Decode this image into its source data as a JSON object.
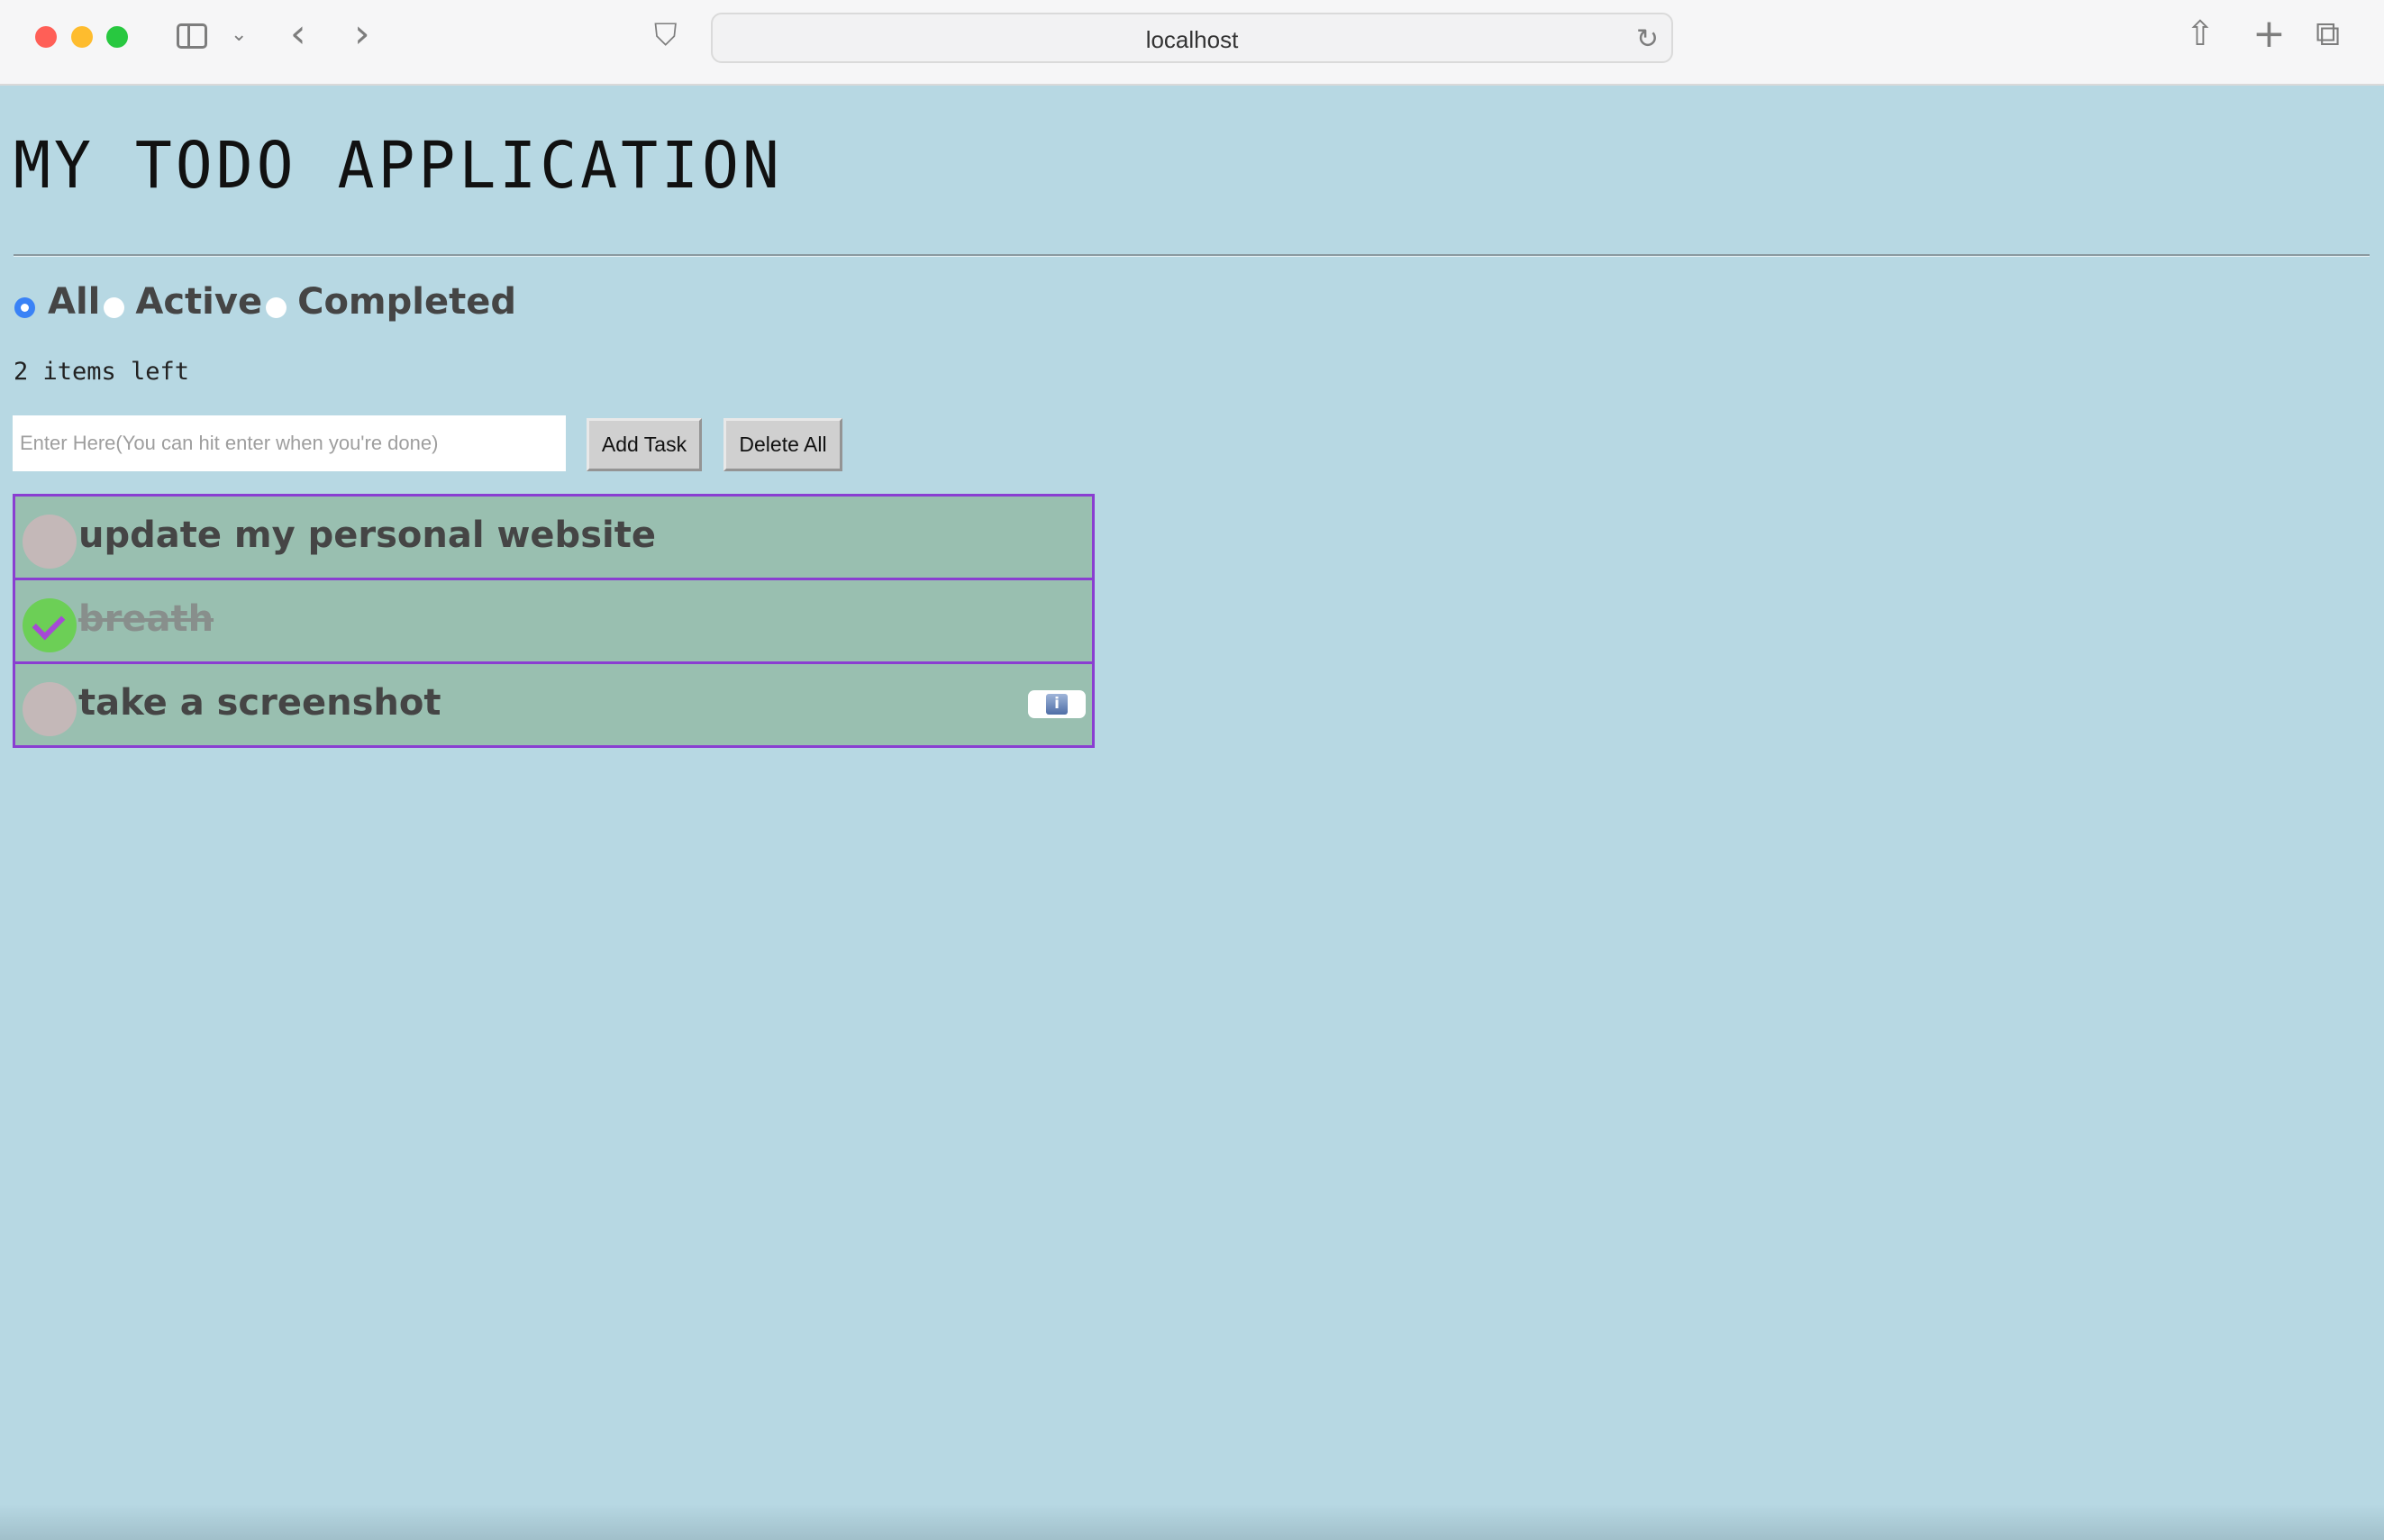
{
  "browser": {
    "url": "localhost",
    "icons": {
      "sidebar": "sidebar-icon",
      "back": "chevron-left-icon",
      "forward": "chevron-right-icon",
      "shield": "shield-icon",
      "reload": "reload-icon",
      "share": "share-icon",
      "new_tab": "plus-icon",
      "tabs": "tabs-overview-icon"
    }
  },
  "app": {
    "title": "MY TODO APPLICATION",
    "filters": [
      {
        "label": "All",
        "selected": true
      },
      {
        "label": "Active",
        "selected": false
      },
      {
        "label": "Completed",
        "selected": false
      }
    ],
    "items_left": "2 items left",
    "input": {
      "value": "",
      "placeholder": "Enter Here(You can hit enter when you're done)"
    },
    "add_button": "Add Task",
    "delete_all_button": "Delete All",
    "todos": [
      {
        "text": "update my personal website",
        "completed": false
      },
      {
        "text": "breath",
        "completed": true
      },
      {
        "text": "take a screenshot",
        "completed": false
      }
    ]
  },
  "colors": {
    "page_bg": "#b7d8e3",
    "item_bg": "#99bfb0",
    "item_border": "#8a3ed1",
    "done_check": "#6ccf56",
    "checkmark": "#a64ad6"
  }
}
